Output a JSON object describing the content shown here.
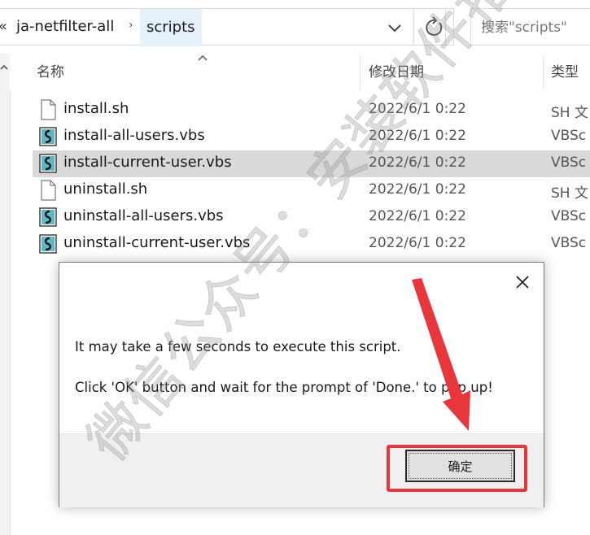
{
  "address_bar": {
    "overflow_chevron": "«",
    "breadcrumbs": [
      {
        "label": "ja-netfilter-all"
      },
      {
        "label": "scripts"
      }
    ],
    "separator": "›",
    "refresh_icon": "refresh-icon",
    "dropdown_icon": "chevron-down-icon"
  },
  "search": {
    "placeholder": "搜索\"scripts\""
  },
  "columns": {
    "name": "名称",
    "date_modified": "修改日期",
    "type": "类型"
  },
  "files": [
    {
      "name": "install.sh",
      "date": "2022/6/1 0:22",
      "type": "SH 文",
      "icon": "generic-file-icon",
      "selected": false
    },
    {
      "name": "install-all-users.vbs",
      "date": "2022/6/1 0:22",
      "type": "VBSc",
      "icon": "vbs-script-icon",
      "selected": false
    },
    {
      "name": "install-current-user.vbs",
      "date": "2022/6/1 0:22",
      "type": "VBSc",
      "icon": "vbs-script-icon",
      "selected": true
    },
    {
      "name": "uninstall.sh",
      "date": "2022/6/1 0:22",
      "type": "SH 文",
      "icon": "generic-file-icon",
      "selected": false
    },
    {
      "name": "uninstall-all-users.vbs",
      "date": "2022/6/1 0:22",
      "type": "VBSc",
      "icon": "vbs-script-icon",
      "selected": false
    },
    {
      "name": "uninstall-current-user.vbs",
      "date": "2022/6/1 0:22",
      "type": "VBSc",
      "icon": "vbs-script-icon",
      "selected": false
    }
  ],
  "dialog": {
    "message_line1": "It may take a few seconds to execute this script.",
    "message_line2": "Click 'OK' button and wait for the prompt of 'Done.' to pop up!",
    "ok_label": "确定",
    "close_icon": "close-icon"
  },
  "annotation": {
    "color": "#e8363d",
    "highlight_target": "ok-button"
  },
  "watermark": {
    "text": "微信公众号：安装软件指南"
  },
  "colors": {
    "selection": "#d9d9d9",
    "dialog_footer": "#f0f0f0",
    "address_selected": "#e5f1fb"
  }
}
